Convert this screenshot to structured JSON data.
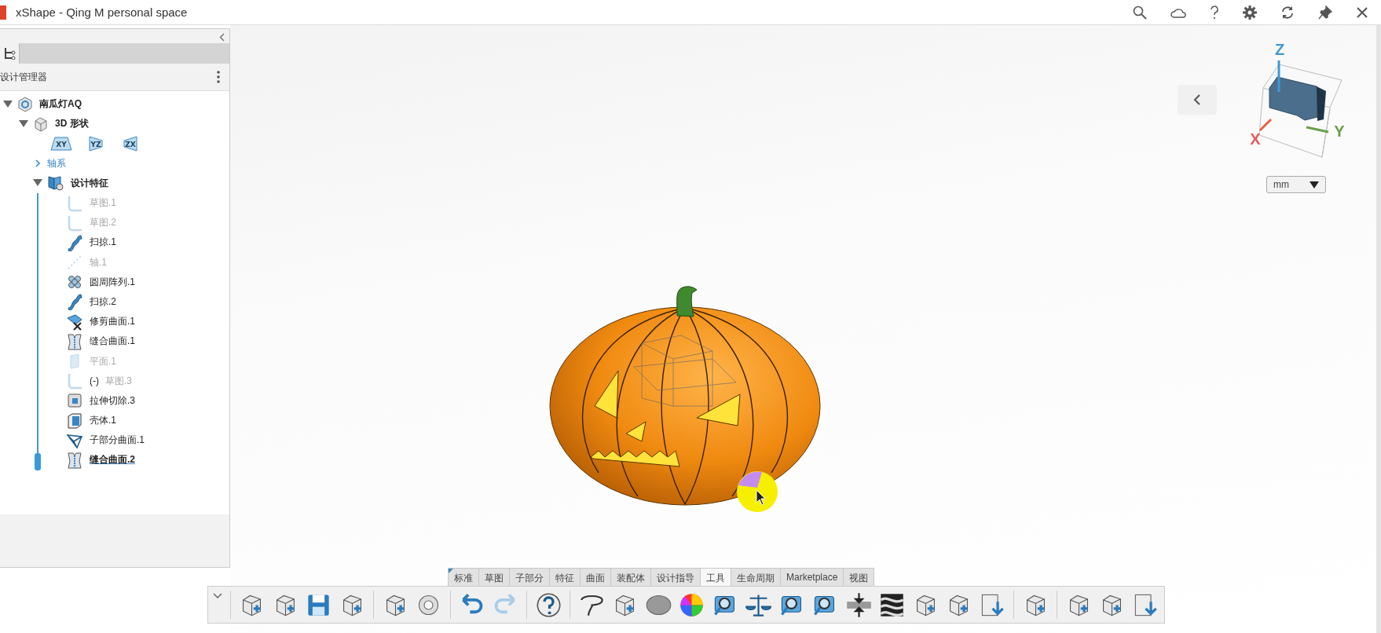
{
  "window": {
    "title": "xShape - Qing M personal space"
  },
  "panel": {
    "heading": "设计管理器",
    "tree": [
      {
        "label": "南瓜灯AQ",
        "expanded": true,
        "children": [
          {
            "label": "3D 形状",
            "expanded": true,
            "planes": [
              "XY",
              "YZ",
              "ZX"
            ],
            "children": [
              {
                "label": "轴系",
                "kind": "axes",
                "expanded": false
              },
              {
                "label": "设计特征",
                "kind": "features",
                "expanded": true,
                "features": [
                  {
                    "label": "草图.1",
                    "kind": "sketch",
                    "suppressed": true,
                    "current": false
                  },
                  {
                    "label": "草图.2",
                    "kind": "sketch",
                    "suppressed": true,
                    "current": false
                  },
                  {
                    "label": "扫掠.1",
                    "kind": "sweep",
                    "suppressed": false,
                    "current": false
                  },
                  {
                    "label": "轴.1",
                    "kind": "axis",
                    "suppressed": true,
                    "current": false
                  },
                  {
                    "label": "圆周阵列.1",
                    "kind": "pattern",
                    "suppressed": false,
                    "current": false
                  },
                  {
                    "label": "扫掠.2",
                    "kind": "sweep",
                    "suppressed": false,
                    "current": false
                  },
                  {
                    "label": "修剪曲面.1",
                    "kind": "trim",
                    "suppressed": false,
                    "current": false
                  },
                  {
                    "label": "缝合曲面.1",
                    "kind": "knit",
                    "suppressed": false,
                    "current": false
                  },
                  {
                    "label": "平面.1",
                    "kind": "plane",
                    "suppressed": true,
                    "current": false
                  },
                  {
                    "label": "草图.3",
                    "prefix": "(-)",
                    "kind": "sketch",
                    "suppressed": true,
                    "current": false
                  },
                  {
                    "label": "拉伸切除.3",
                    "kind": "cut",
                    "suppressed": false,
                    "current": false
                  },
                  {
                    "label": "壳体.1",
                    "kind": "shell",
                    "suppressed": false,
                    "current": false
                  },
                  {
                    "label": "子部分曲面.1",
                    "kind": "subd",
                    "suppressed": false,
                    "current": false
                  },
                  {
                    "label": "缝合曲面.2",
                    "kind": "knit",
                    "suppressed": false,
                    "current": true
                  }
                ]
              }
            ]
          }
        ]
      }
    ]
  },
  "viewport": {
    "axes": [
      "X",
      "Y",
      "Z"
    ],
    "unit": "mm"
  },
  "ribbon": {
    "tabs": [
      {
        "label": "标准",
        "selected": false
      },
      {
        "label": "草图",
        "selected": false
      },
      {
        "label": "子部分",
        "selected": false
      },
      {
        "label": "特征",
        "selected": false
      },
      {
        "label": "曲面",
        "selected": false
      },
      {
        "label": "装配体",
        "selected": false
      },
      {
        "label": "设计指导",
        "selected": false
      },
      {
        "label": "工具",
        "selected": true
      },
      {
        "label": "生命周期",
        "selected": false
      },
      {
        "label": "Marketplace",
        "selected": false
      },
      {
        "label": "视图",
        "selected": false
      }
    ]
  }
}
